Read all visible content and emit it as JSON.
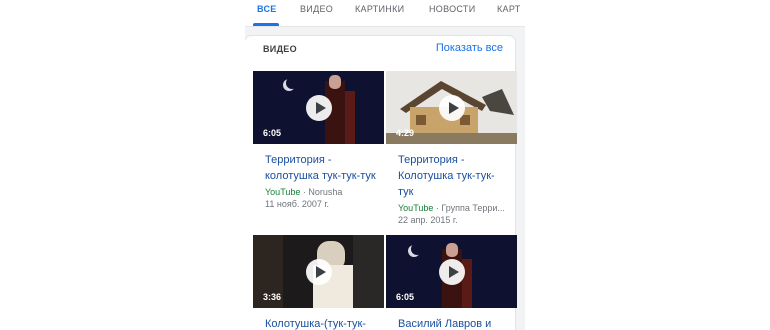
{
  "tabs": [
    {
      "label": "ВСЕ",
      "active": true
    },
    {
      "label": "ВИДЕО",
      "active": false
    },
    {
      "label": "КАРТИНКИ",
      "active": false
    },
    {
      "label": "НОВОСТИ",
      "active": false
    },
    {
      "label": "КАРТ",
      "active": false
    }
  ],
  "section": {
    "title": "ВИДЕО",
    "show_all": "Показать все"
  },
  "videos": [
    {
      "duration": "6:05",
      "title": "Территория - колотушка тук-тук-тук",
      "platform": "YouTube",
      "channel": " · Norusha",
      "date": "11 нояб. 2007 г."
    },
    {
      "duration": "4:29",
      "title": "Территория - Колотушка тук-тук-тук",
      "platform": "YouTube",
      "channel": " · Группа Терри...",
      "date": "22 апр. 2015 г."
    },
    {
      "duration": "3:36",
      "title": "Колотушка-(тук-тук-",
      "platform": "",
      "channel": "",
      "date": ""
    },
    {
      "duration": "6:05",
      "title": "Василий Лавров и",
      "platform": "",
      "channel": "",
      "date": ""
    }
  ],
  "colors": {
    "accent": "#1a73e8",
    "link": "#1a4fa0",
    "youtube_green": "#188038"
  }
}
